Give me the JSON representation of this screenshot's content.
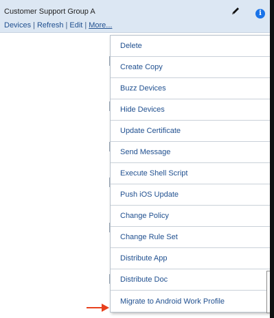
{
  "header": {
    "title": "Customer Support Group A",
    "links": [
      "Devices",
      "Refresh",
      "Edit",
      "More..."
    ],
    "pencil_icon": "pencil-icon",
    "info_icon_glyph": "i"
  },
  "menu": {
    "items": [
      "Delete",
      "Create Copy",
      "Buzz Devices",
      "Hide Devices",
      "Update Certificate",
      "Send Message",
      "Execute Shell Script",
      "Push iOS Update",
      "Change Policy",
      "Change Rule Set",
      "Distribute App",
      "Distribute Doc",
      "Migrate to Android Work Profile"
    ]
  },
  "colors": {
    "header_bg": "#dce7f3",
    "link": "#1f4f8f",
    "arrow": "#e8401c",
    "info": "#1a73e8"
  }
}
